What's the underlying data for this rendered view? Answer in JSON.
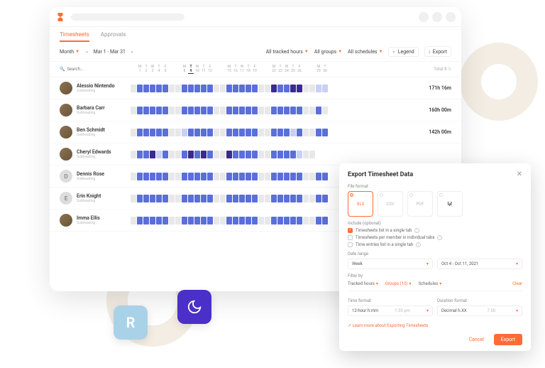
{
  "tabs": {
    "timesheets": "Timesheets",
    "approvals": "Approvals"
  },
  "toolbar": {
    "period": "Month",
    "range": "Mar 1 - Mar 31",
    "filter_hours": "All tracked hours",
    "filter_groups": "All groups",
    "filter_schedules": "All schedules",
    "legend": "Legend",
    "export": "Export"
  },
  "header": {
    "search_placeholder": "Search...",
    "total_label": "Total",
    "total_count": "8",
    "days": [
      "",
      "M",
      "T",
      "W",
      "T",
      "F",
      "",
      "",
      "M",
      "T",
      "W",
      "T",
      "F",
      "",
      "",
      "M",
      "T",
      "W",
      "T",
      "F",
      "",
      "",
      "M",
      "T",
      "W",
      "T",
      "F",
      "",
      "",
      "M",
      "T"
    ],
    "nums": [
      "",
      "1",
      "2",
      "3",
      "4",
      "5",
      "",
      "",
      "8",
      "9",
      "10",
      "11",
      "12",
      "",
      "",
      "15",
      "16",
      "17",
      "18",
      "19",
      "",
      "",
      "22",
      "23",
      "24",
      "25",
      "26",
      "",
      "",
      "29",
      "30"
    ],
    "today_index": 9
  },
  "people": [
    {
      "name": "Alessio Nintendo",
      "sub": "Subheading",
      "total": "171h 16m",
      "avatar": "img",
      "cells": [
        "g",
        "b",
        "b",
        "b",
        "b",
        "b",
        "g",
        "g",
        "b",
        "b",
        "b",
        "b",
        "b",
        "g",
        "g",
        "b",
        "b",
        "b",
        "b",
        "b",
        "g",
        "g",
        "d",
        "b",
        "b",
        "d",
        "d",
        "g",
        "g",
        "l",
        "l"
      ]
    },
    {
      "name": "Barbara Carr",
      "sub": "Subheading",
      "total": "160h 00m",
      "avatar": "img",
      "cells": [
        "g",
        "b",
        "b",
        "b",
        "b",
        "b",
        "g",
        "g",
        "b",
        "b",
        "b",
        "b",
        "b",
        "g",
        "g",
        "b",
        "b",
        "b",
        "b",
        "b",
        "g",
        "g",
        "b",
        "b",
        "b",
        "b",
        "b",
        "g",
        "g",
        "b",
        "g"
      ]
    },
    {
      "name": "Ben Schmidt",
      "sub": "Subheading",
      "total": "142h 00m",
      "avatar": "img",
      "cells": [
        "g",
        "b",
        "b",
        "b",
        "b",
        "b",
        "g",
        "g",
        "l",
        "b",
        "b",
        "b",
        "b",
        "g",
        "g",
        "b",
        "b",
        "b",
        "b",
        "b",
        "g",
        "g",
        "b",
        "b",
        "b",
        "l",
        "b",
        "g",
        "g",
        "b",
        "b"
      ]
    },
    {
      "name": "Cheryl Edwards",
      "sub": "Subheading",
      "total": "",
      "avatar": "img",
      "cells": [
        "g",
        "b",
        "b",
        "d",
        "l",
        "b",
        "g",
        "g",
        "b",
        "d",
        "b",
        "d",
        "b",
        "g",
        "g",
        "d",
        "b",
        "b",
        "b",
        "b",
        "g",
        "g",
        "b",
        "b",
        "b",
        "b",
        "l",
        "g",
        "g",
        "e",
        "e"
      ]
    },
    {
      "name": "Dennis Rose",
      "sub": "Subheading",
      "total": "",
      "avatar": "D",
      "cells": [
        "g",
        "b",
        "b",
        "b",
        "b",
        "b",
        "g",
        "g",
        "b",
        "b",
        "b",
        "b",
        "b",
        "g",
        "g",
        "b",
        "b",
        "b",
        "b",
        "b",
        "g",
        "g",
        "b",
        "b",
        "b",
        "b",
        "b",
        "g",
        "g",
        "b",
        "b"
      ]
    },
    {
      "name": "Erin Knight",
      "sub": "Subheading",
      "total": "",
      "avatar": "E",
      "cells": [
        "g",
        "b",
        "b",
        "b",
        "b",
        "b",
        "g",
        "g",
        "b",
        "b",
        "b",
        "b",
        "b",
        "g",
        "g",
        "b",
        "b",
        "b",
        "b",
        "b",
        "g",
        "g",
        "b",
        "b",
        "b",
        "b",
        "b",
        "g",
        "g",
        "b",
        "b"
      ]
    },
    {
      "name": "Imma Ellis",
      "sub": "Subheading",
      "total": "",
      "avatar": "img",
      "cells": [
        "g",
        "b",
        "b",
        "b",
        "b",
        "b",
        "g",
        "g",
        "b",
        "b",
        "b",
        "b",
        "b",
        "g",
        "g",
        "b",
        "b",
        "b",
        "b",
        "b",
        "g",
        "g",
        "b",
        "b",
        "b",
        "b",
        "b",
        "g",
        "g",
        "b",
        "b"
      ]
    }
  ],
  "export": {
    "title": "Export Timesheet Data",
    "file_format_label": "File format",
    "formats": [
      "XLS",
      "CSV",
      "PDF",
      ""
    ],
    "include_label": "Include (optional)",
    "opts": [
      "Timesheets list in a single tab",
      "Timesheets per member in individual tabs",
      "Time entries list in a single tab"
    ],
    "date_range_label": "Date range",
    "date_period": "Week",
    "date_value": "Oct 4 - Oct 11, 2021",
    "filter_label": "Filter by",
    "filter_tracked": "Tracked hours",
    "filter_groups": "Groups (10)",
    "filter_schedules": "Schedules",
    "clear": "Clear",
    "time_format_label": "Time format",
    "time_format_value": "12-hour h:mm",
    "time_format_example": "1:30 pm",
    "duration_format_label": "Duration format",
    "duration_format_value": "Decimal h.XX",
    "duration_format_example": "7.50",
    "learn": "Learn more about Exporting Timesheets",
    "cancel": "Cancel",
    "export_btn": "Export"
  },
  "badges": {
    "r": "R"
  }
}
